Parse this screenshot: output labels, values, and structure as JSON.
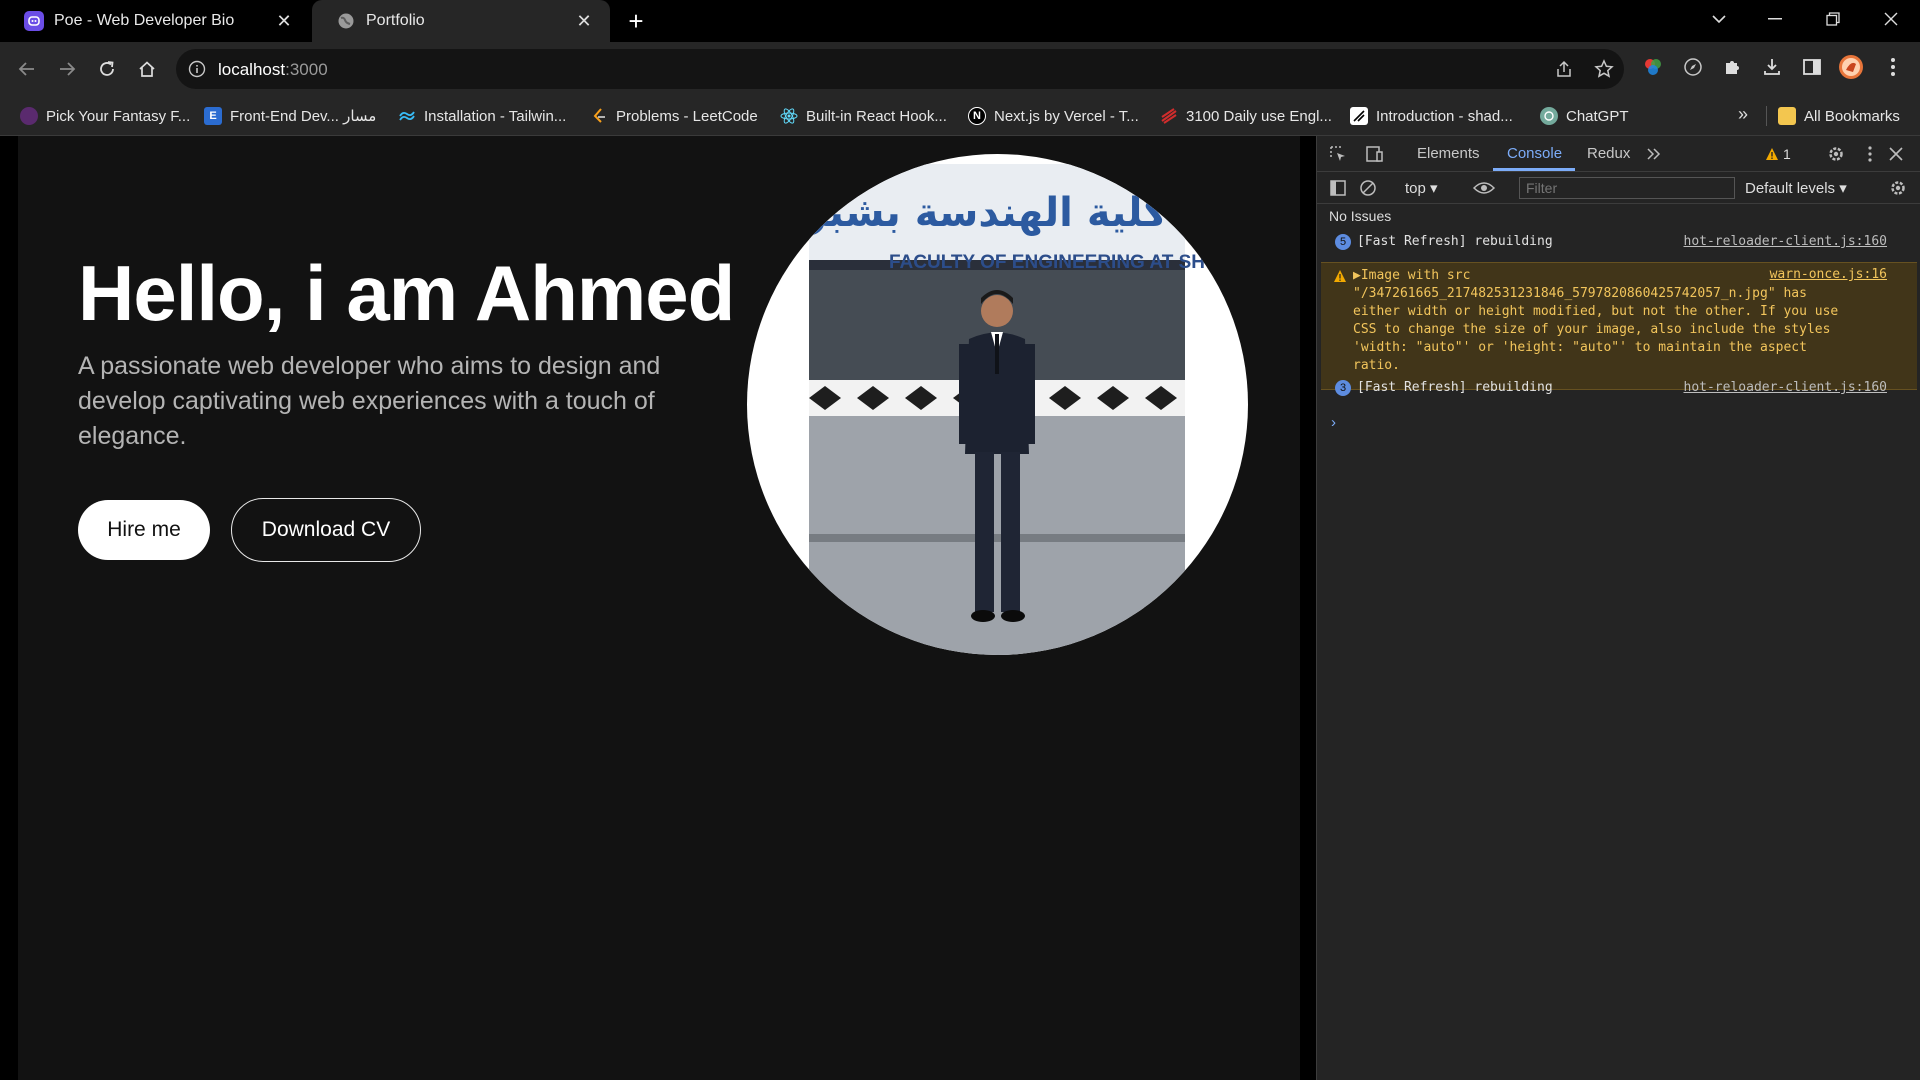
{
  "browser": {
    "tabs": [
      {
        "title": "Poe - Web Developer Bio",
        "icon": "poe-icon",
        "active": false
      },
      {
        "title": "Portfolio",
        "icon": "globe-icon",
        "active": true
      }
    ],
    "address": {
      "host": "localhost",
      "port": ":3000"
    },
    "bookmarks": [
      {
        "label": "Pick Your Fantasy F...",
        "icon": "fantasy-icon",
        "color": "#5a2a6e"
      },
      {
        "label": "Front-End Dev... مسار",
        "icon": "E",
        "color": "#2b6cd1"
      },
      {
        "label": "Installation - Tailwin...",
        "icon": "tailwind-icon",
        "color": "#38bdf8"
      },
      {
        "label": "Problems - LeetCode",
        "icon": "leetcode-icon",
        "color": "#f89f1b"
      },
      {
        "label": "Built-in React Hook...",
        "icon": "react-icon",
        "color": "#61dafb"
      },
      {
        "label": "Next.js by Vercel - T...",
        "icon": "N",
        "color": "#000000"
      },
      {
        "label": "3100 Daily use Engl...",
        "icon": "english-icon",
        "color": "#d12c2c"
      },
      {
        "label": "Introduction - shad...",
        "icon": "shadcn-icon",
        "color": "#000000"
      },
      {
        "label": "ChatGPT",
        "icon": "chatgpt-icon",
        "color": "#74aa9c"
      }
    ],
    "bookmarks_more": "»",
    "all_bookmarks": "All Bookmarks"
  },
  "page": {
    "title": "Hello, i am Ahmed",
    "subtitle": "A passionate web developer who aims to design and develop captivating web experiences with a touch of elegance.",
    "hire_label": "Hire me",
    "cv_label": "Download CV",
    "photo_sign_arabic": "كلية الهندسة بشبرا",
    "photo_sign_english": "FACULTY OF ENGINEERING AT SHOUBRA"
  },
  "devtools": {
    "tabs": [
      "Elements",
      "Console",
      "Redux"
    ],
    "active_tab": "Console",
    "warning_count": "1",
    "context": "top",
    "filter_placeholder": "Filter",
    "levels": "Default levels",
    "issues": "No Issues",
    "logs": [
      {
        "count": "5",
        "message": "[Fast Refresh] rebuilding",
        "source": "hot-reloader-client.js:160"
      },
      {
        "count": "3",
        "message": "[Fast Refresh] rebuilding",
        "source": "hot-reloader-client.js:160"
      }
    ],
    "warning": {
      "text": "▶Image with src\n\"/347261665_217482531231846_5797820860425742057_n.jpg\" has\neither width or height modified, but not the other. If you use\nCSS to change the size of your image, also include the styles\n'width: \"auto\"' or 'height: \"auto\"' to maintain the aspect\nratio.",
      "source": "warn-once.js:16"
    },
    "prompt": "›"
  }
}
